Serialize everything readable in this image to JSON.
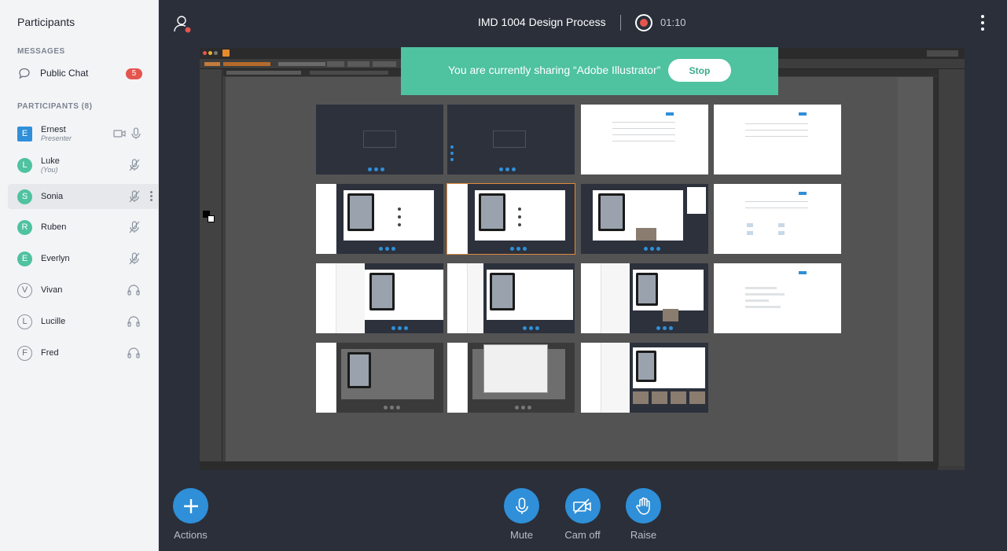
{
  "sidebar": {
    "title": "Participants",
    "messages_heading": "MESSAGES",
    "public_chat": {
      "label": "Public Chat",
      "unread": "5"
    },
    "participants_heading": "PARTICIPANTS (8)",
    "participants": [
      {
        "initial": "E",
        "name": "Ernest",
        "sub": "Presenter",
        "color": "#2f8fd8",
        "style": "square",
        "status": [
          "camera-icon",
          "mic-icon"
        ]
      },
      {
        "initial": "L",
        "name": "Luke",
        "sub": "(You)",
        "color": "#4fc2a0",
        "style": "round",
        "status": [
          "mic-muted-icon"
        ]
      },
      {
        "initial": "S",
        "name": "Sonia",
        "sub": "",
        "color": "#4fc2a0",
        "style": "round",
        "status": [
          "mic-muted-icon"
        ],
        "selected": true
      },
      {
        "initial": "R",
        "name": "Ruben",
        "sub": "",
        "color": "#4fc2a0",
        "style": "round",
        "status": [
          "mic-muted-icon"
        ]
      },
      {
        "initial": "E",
        "name": "Everlyn",
        "sub": "",
        "color": "#4fc2a0",
        "style": "round",
        "status": [
          "mic-muted-icon"
        ]
      },
      {
        "initial": "V",
        "name": "Vivan",
        "sub": "",
        "color": "",
        "style": "outline",
        "status": [
          "headphones-icon"
        ]
      },
      {
        "initial": "L",
        "name": "Lucille",
        "sub": "",
        "color": "",
        "style": "outline",
        "status": [
          "headphones-icon"
        ]
      },
      {
        "initial": "F",
        "name": "Fred",
        "sub": "",
        "color": "",
        "style": "outline",
        "status": [
          "headphones-icon"
        ]
      }
    ]
  },
  "header": {
    "title": "IMD 1004 Design Process",
    "recording_time": "01:10"
  },
  "share_banner": {
    "text": "You are currently sharing “Adobe Illustrator”",
    "stop_label": "Stop"
  },
  "controls": {
    "actions": "Actions",
    "mute": "Mute",
    "cam_off": "Cam off",
    "raise": "Raise"
  },
  "colors": {
    "accent": "#2f8fd8",
    "banner": "#4fc2a0",
    "alert": "#e4554e",
    "background": "#2a2f3a"
  }
}
